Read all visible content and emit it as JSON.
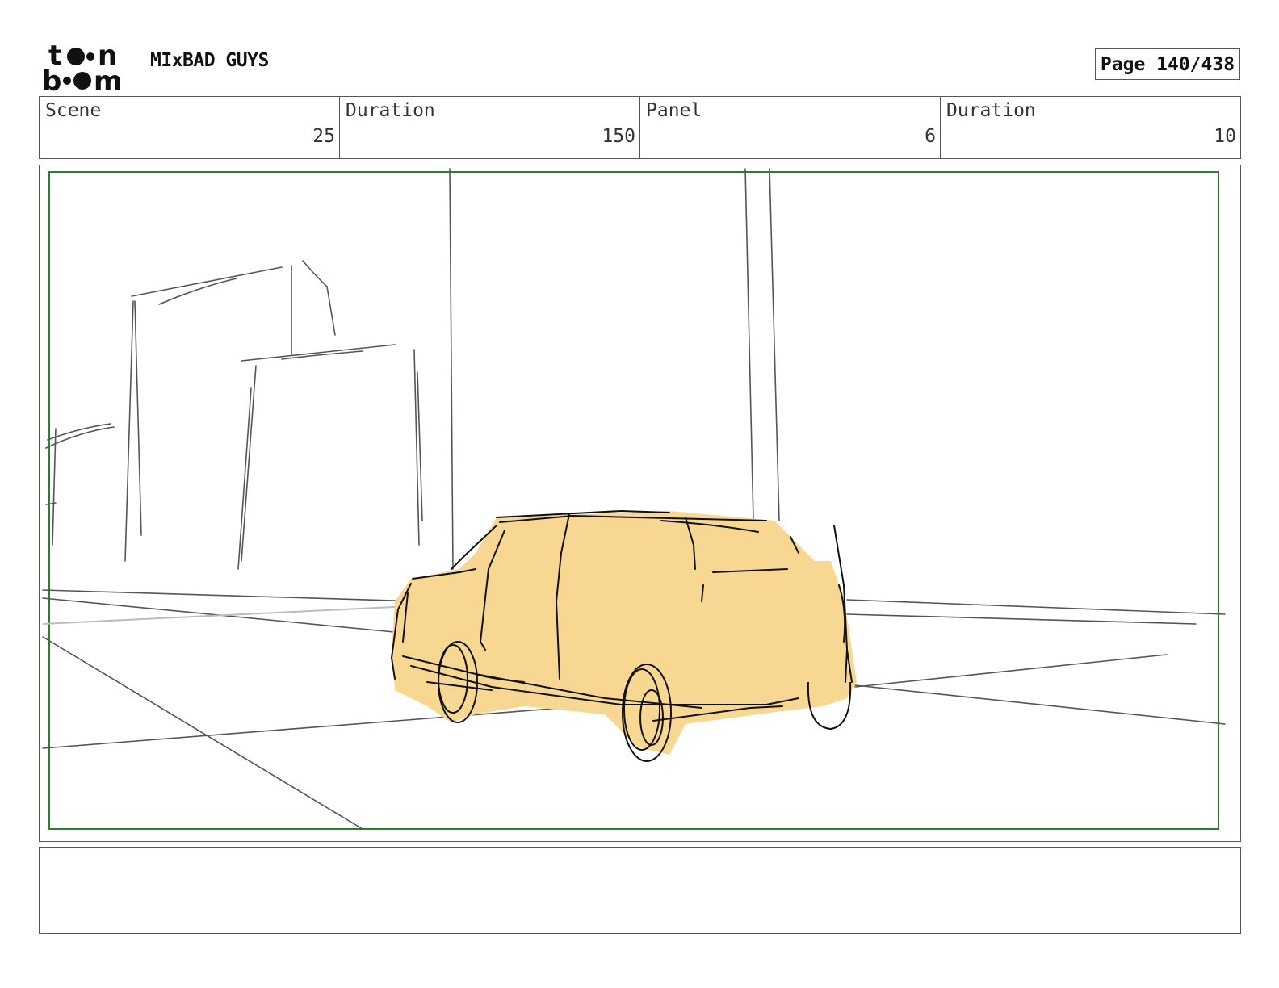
{
  "header": {
    "logo_text": "toon boom",
    "project_title": "MIxBAD GUYS",
    "page_label": "Page 140/438"
  },
  "info": {
    "scene_label": "Scene",
    "scene_value": "25",
    "scene_duration_label": "Duration",
    "scene_duration_value": "150",
    "panel_label": "Panel",
    "panel_value": "6",
    "panel_duration_label": "Duration",
    "panel_duration_value": "10"
  },
  "panel": {
    "safe_area_color": "#2e7d32",
    "car_fill_color": "#f7d792",
    "sketch_line_color": "#555555",
    "ink_color": "#111111"
  },
  "notes": {
    "text": ""
  }
}
